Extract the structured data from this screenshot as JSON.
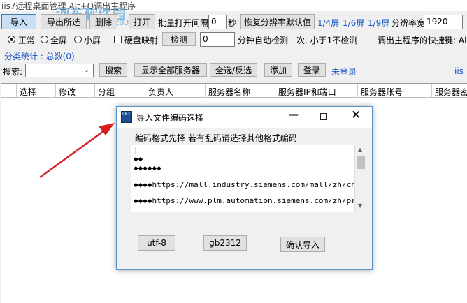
{
  "window": {
    "title": "iis7远程桌面管理 Alt+Q调出主程序",
    "watermark": "河东软件园",
    "watermark_url": "www.pc0359.cn"
  },
  "toolbar": {
    "import_label": "导入",
    "export_label": "导出所选",
    "delete_label": "删除",
    "open_label": "打开",
    "batch_interval_label": "批量打开间隔",
    "interval_value": "0",
    "seconds_label": "秒",
    "restore_resolution_label": "恢复分辨率默认值",
    "screen_quarter": "1/4屏",
    "screen_sixth": "1/6屏",
    "screen_ninth": "1/9屏",
    "resolution_label": "分辨率",
    "width_label": "宽",
    "width_value": "1920"
  },
  "row2": {
    "normal_label": "正常",
    "fullscreen_label": "全屏",
    "small_label": "小屏",
    "disk_map_label": "硬盘映射",
    "detect_label": "检测",
    "detect_value": "0",
    "detect_hint": "分钟自动检测一次, 小于1不检测",
    "hotkey_label": "调出主程序的快捷键: Al"
  },
  "stats": {
    "label": "分类统计 : 总数(0)"
  },
  "search_row": {
    "search_label": "搜索:",
    "search_value": "",
    "search_button": "搜索",
    "show_all_button": "显示全部服务器",
    "select_all_button": "全选/反选",
    "add_button": "添加",
    "login_button": "登录",
    "not_logged_in": "未登录",
    "iis_link": "iis"
  },
  "grid": {
    "columns": [
      "选择",
      "修改",
      "分组",
      "负责人",
      "服务器名称",
      "服务器IP和端口",
      "服务器账号",
      "服务器密"
    ]
  },
  "dialog": {
    "icon_text": "IIS7",
    "title": "导入文件编码选择",
    "prompt": "编码格式先择 若有乱码请选择其他格式编码",
    "lines": [
      "",
      "◆◆",
      "◆◆◆◆◆◆",
      "",
      "◆◆◆◆https://mall.industry.siemens.com/mall/zh/cn/Cat",
      "",
      "◆◆◆◆https://www.plm.automation.siemens.com/zh/produc"
    ],
    "utf8_button": "utf-8",
    "gb2312_button": "gb2312",
    "confirm_button": "确认导入"
  },
  "colors": {
    "arrow": "#d62020",
    "link": "#1a56c8",
    "dialog_border": "#5b8fc7"
  }
}
